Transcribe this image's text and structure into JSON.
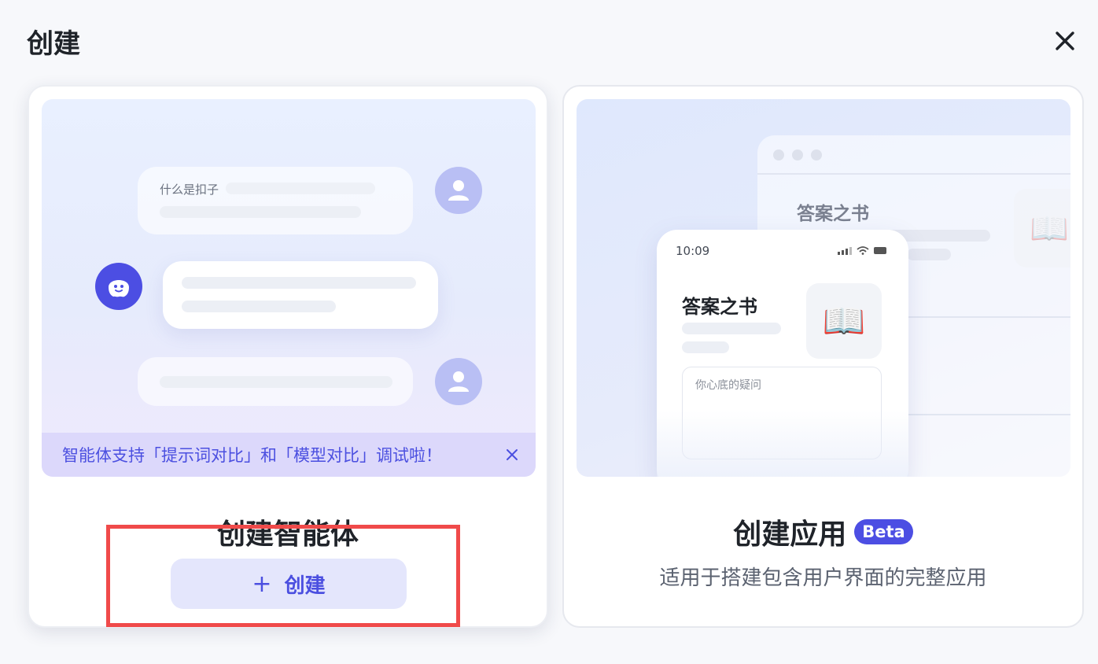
{
  "dialog": {
    "title": "创建"
  },
  "agent_card": {
    "question_text": "什么是扣子",
    "notice": "智能体支持「提示词对比」和「模型对比」调试啦！",
    "title": "创建智能体",
    "button_icon": "+",
    "button_label": "创建"
  },
  "app_card": {
    "window_title": "答案之书",
    "phone_time": "10:09",
    "phone_title": "答案之书",
    "phone_placeholder": "你心底的疑问",
    "title": "创建应用",
    "badge": "Beta",
    "description": "适用于搭建包含用户界面的完整应用"
  },
  "colors": {
    "accent": "#4c4ee3",
    "highlight": "#f04a4a",
    "notice_bg": "#dcd8fb"
  }
}
